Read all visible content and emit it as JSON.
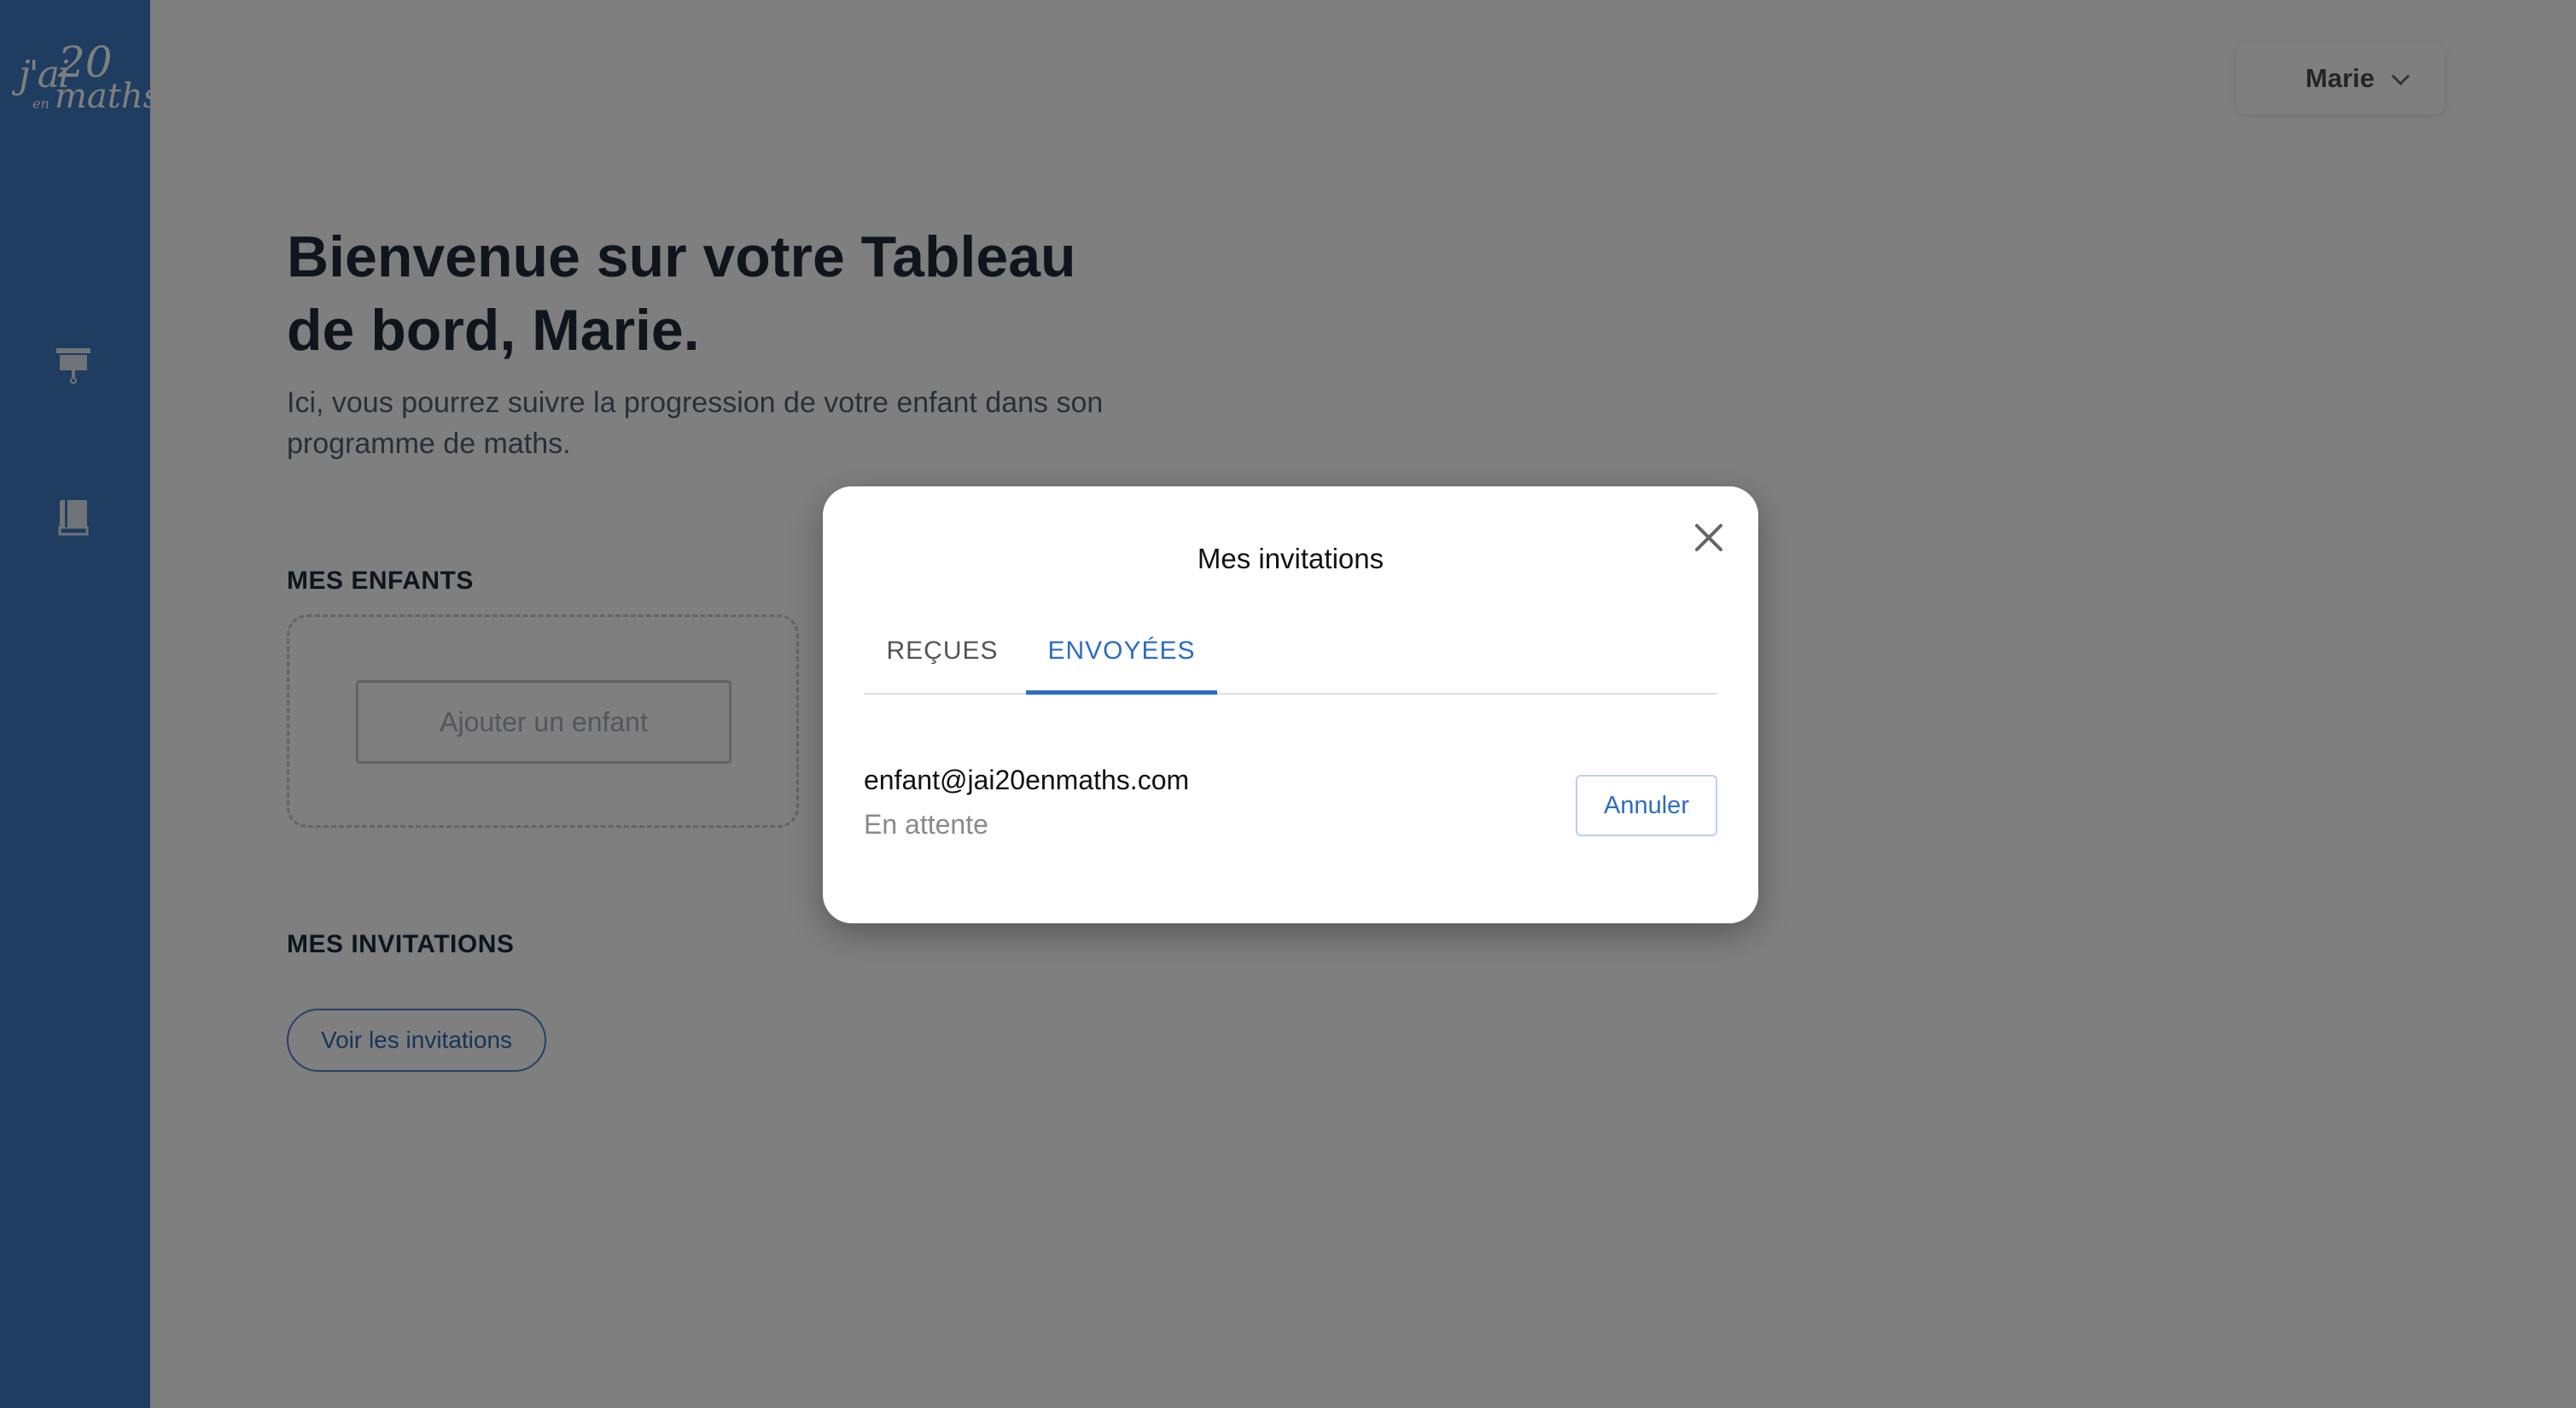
{
  "brand": {
    "logo_text_1": "j'ai",
    "logo_text_2": "20",
    "logo_text_3": "en",
    "logo_text_4": "maths",
    "sidebar_color": "#3c7bc0"
  },
  "sidebar": {
    "items": [
      {
        "icon": "presentation-board-icon"
      },
      {
        "icon": "book-icon"
      }
    ]
  },
  "header": {
    "user_name": "Marie",
    "user_menu_icon": "chevron-down-icon"
  },
  "dashboard": {
    "welcome_title": "Bienvenue sur votre Tableau de bord, Marie.",
    "subtitle": "Ici, vous pourrez suivre la progression de votre enfant dans son programme de maths.",
    "children_section_title": "MES ENFANTS",
    "add_child_label": "Ajouter un enfant",
    "invitations_section_title": "MES INVITATIONS",
    "view_invitations_label": "Voir les invitations"
  },
  "modal": {
    "title": "Mes invitations",
    "close_icon": "close-icon",
    "tabs": [
      {
        "label": "REÇUES",
        "active": false
      },
      {
        "label": "ENVOYÉES",
        "active": true
      }
    ],
    "invitations": [
      {
        "email": "enfant@jai20enmaths.com",
        "status": "En attente",
        "action_label": "Annuler"
      }
    ]
  },
  "colors": {
    "accent": "#2b6cc4",
    "overlay": "rgba(0,0,0,0.5)"
  }
}
